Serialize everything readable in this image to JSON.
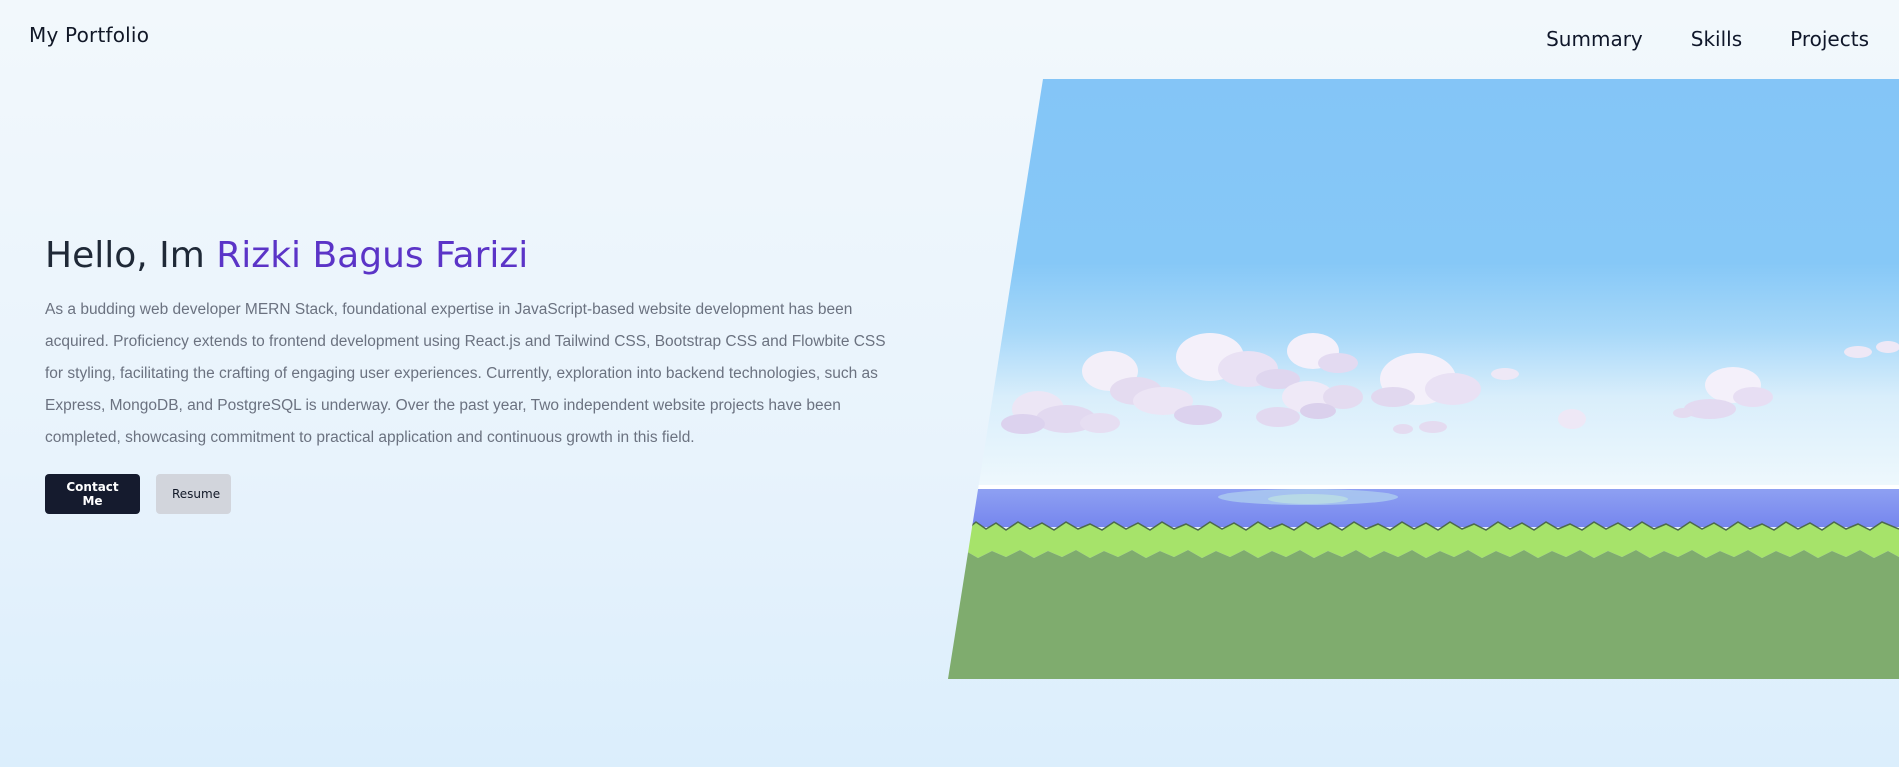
{
  "header": {
    "brand": "My Portfolio",
    "nav": [
      "Summary",
      "Skills",
      "Projects"
    ]
  },
  "hero": {
    "greeting": "Hello, Im",
    "name": "Rizki Bagus Farizi",
    "bio": "As a budding web developer MERN Stack, foundational expertise in JavaScript-based website development has been acquired. Proficiency extends to frontend development using React.js and Tailwind CSS, Bootstrap CSS and Flowbite CSS for styling, facilitating the crafting of engaging user experiences. Currently, exploration into backend technologies, such as Express, MongoDB, and PostgreSQL is underway. Over the past year, Two independent website projects have been completed, showcasing commitment to practical application and continuous growth in this field.",
    "buttons": {
      "contact": "Contact Me",
      "resume": "Resume"
    }
  },
  "colors": {
    "accent": "#5b34c7",
    "primary_button": "#151b2e",
    "secondary_button": "#d2d5dc",
    "sky": "#84c5f7",
    "water": "#7b8cf0",
    "grass": "#a6e36a",
    "ground": "#7fac6e"
  },
  "illustration": {
    "type": "pixel-art-landscape",
    "elements": [
      "sky",
      "clouds",
      "sea",
      "grass",
      "ground"
    ]
  }
}
